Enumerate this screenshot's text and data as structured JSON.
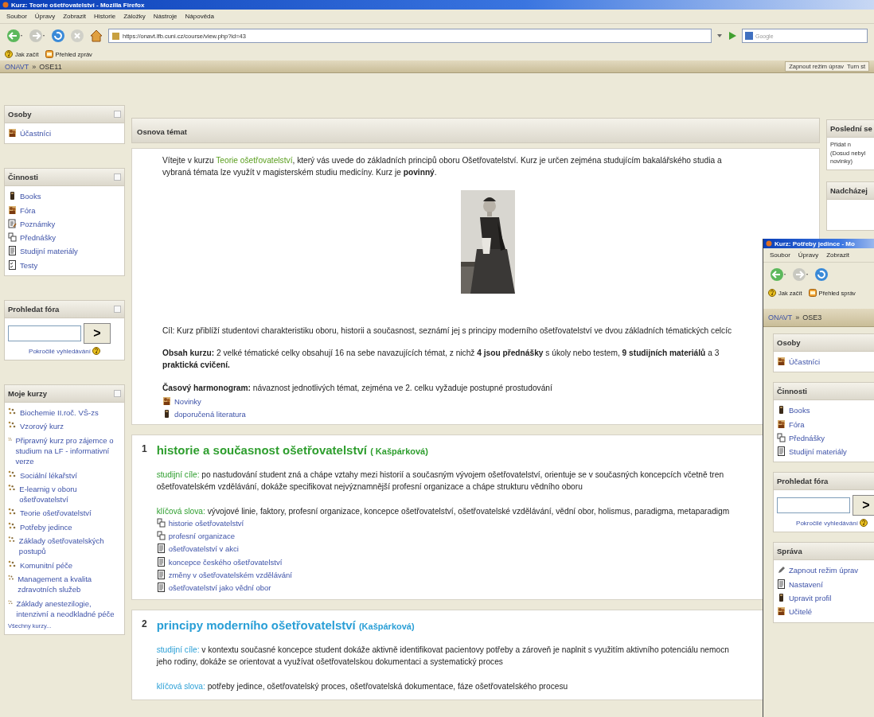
{
  "window": {
    "title": "Kurz: Teorie ošetřovatelství - Mozilla Firefox",
    "menu": [
      "Soubor",
      "Úpravy",
      "Zobrazit",
      "Historie",
      "Záložky",
      "Nástroje",
      "Nápověda"
    ],
    "address": "https://onavt.lfb.cuni.cz/course/view.php?id=43",
    "search_placeholder": "Google",
    "bookmarks": [
      {
        "label": "Jak začít",
        "kind": "help"
      },
      {
        "label": "Přehled zpráv",
        "kind": "feed"
      }
    ],
    "breadcrumb": {
      "home": "ONAVT",
      "separator": "»",
      "current": "OSE11"
    },
    "header_links": [
      "Zapnout režim úprav",
      "Turn st"
    ]
  },
  "left_blocks": [
    {
      "title": "Osoby",
      "kind": "list",
      "items": [
        {
          "label": "Účastníci",
          "kind": "people"
        }
      ]
    },
    {
      "title": "Činnosti",
      "kind": "list",
      "items": [
        {
          "label": "Books",
          "kind": "book"
        },
        {
          "label": "Fóra",
          "kind": "people"
        },
        {
          "label": "Poznámky",
          "kind": "notes"
        },
        {
          "label": "Přednášky",
          "kind": "lesson"
        },
        {
          "label": "Studijní materiály",
          "kind": "resource"
        },
        {
          "label": "Testy",
          "kind": "quiz"
        }
      ]
    },
    {
      "title": "Prohledat fóra",
      "kind": "search",
      "button": ">",
      "link": "Pokročilé vyhledávání"
    },
    {
      "title": "Moje kurzy",
      "kind": "list",
      "items": [
        {
          "label": "Biochemie II.roč. VŠ-zs",
          "kind": "course"
        },
        {
          "label": "Vzorový kurz",
          "kind": "course"
        },
        {
          "label": "Připravný kurz pro zájemce o studium na LF - informativní verze",
          "kind": "course"
        },
        {
          "label": "Sociální lékařství",
          "kind": "course"
        },
        {
          "label": "E-learnig v oboru ošetřovatelství",
          "kind": "course"
        },
        {
          "label": "Teorie ošetřovatelství",
          "kind": "course"
        },
        {
          "label": "Potřeby jedince",
          "kind": "course"
        },
        {
          "label": "Základy ošetřovatelských postupů",
          "kind": "course"
        },
        {
          "label": "Komunitní péče",
          "kind": "course"
        },
        {
          "label": "Management a kvalita zdravotních služeb",
          "kind": "course"
        },
        {
          "label": "Základy anestezilogie, intenzivní a neodkladné péče",
          "kind": "course"
        }
      ],
      "footer": "Všechny kurzy..."
    }
  ],
  "center": {
    "title": "Osnova témat",
    "intro": {
      "before": "Vítejte v kurzu ",
      "link": "Teorie ošetřovatelství",
      "after": ", který vás uvede do základních principů oboru Ošetřovatelství. Kurz je určen zejména studujícím bakalářského studia a vybraná témata lze využít v magisterském studiu medicíny. Kurz je **povinný**."
    },
    "paragraphs": [
      {
        "lines": [
          "Cíl: Kurz přiblíží studentovi charakteristiku oboru, historii a současnost, seznámí jej s principy moderního ošetřovatelství ve dvou základních tématických celcíc"
        ]
      },
      {
        "lines": [
          "**Obsah kurzu:** 2 velké tématické celky obsahují 16 na sebe navazujících témat, z nichž **4 jsou přednášky** s úkoly nebo testem, **9 studijních materiálů** a 3",
          "**praktická cvičení.**"
        ]
      },
      {
        "lines": [
          "**Časový harmonogram:** návaznost jednotlivých témat, zejména ve 2. celku vyžaduje postupné prostudování"
        ]
      }
    ],
    "links": [
      {
        "label": "Novinky",
        "kind": "people"
      },
      {
        "label": "doporučená literatura",
        "kind": "book"
      }
    ],
    "sections": [
      {
        "number": "1",
        "title": "historie a současnost ošetřovatelství",
        "author": "( Kašpárková)",
        "color": "#2e9e2e",
        "blocks": [
          {
            "label": "studijní cíle:",
            "lines": [
              "po nastudování student zná a chápe vztahy mezi historií a současným vývojem ošetřovatelství, orientuje se v současných koncepcích včetně tren",
              "ošetřovatelském vzdělávání, dokáže specifikovat nejvýznamnější profesní organizace a chápe strukturu vědního oboru"
            ]
          },
          {
            "label": "klíčová slova:",
            "lines": [
              "vývojové linie, faktory, profesní organizace, koncepce ošetřovatelství, ošetřovatelské vzdělávání, vědní obor, holismus, paradigma, metaparadigm"
            ]
          }
        ],
        "links": [
          {
            "label": "historie ošetřovatelství",
            "kind": "lesson"
          },
          {
            "label": "profesní organizace",
            "kind": "lesson"
          },
          {
            "label": "ošetřovatelství v akci",
            "kind": "resource"
          },
          {
            "label": "koncepce českého ošetřovatelství",
            "kind": "resource"
          },
          {
            "label": "změny v ošetřovatelském vzdělávání",
            "kind": "resource"
          },
          {
            "label": "ošetřovatelství jako vědní obor",
            "kind": "resource"
          }
        ]
      },
      {
        "number": "2",
        "title": "principy moderního ošetřovatelství",
        "author": "(Kašpárková)",
        "color": "#2a9fd6",
        "blocks": [
          {
            "label": "studijní cíle:",
            "lines": [
              "v kontextu současné koncepce student dokáže aktivně identifikovat pacientovy potřeby a zároveň je naplnit s využitím aktivního potenciálu nemocn",
              "jeho rodiny, dokáže se orientovat a využívat ošetřovatelskou dokumentaci a systematický proces"
            ]
          },
          {
            "label": "klíčová slova:",
            "lines": [
              "potřeby jedince, ošetřovatelský proces, ošetřovatelská dokumentace, fáze ošetřovatelského procesu"
            ]
          }
        ]
      }
    ]
  },
  "right_blocks": [
    {
      "title": "Poslední se",
      "lines": [
        "Přidat n",
        "(Dosud nebyl",
        "novinky)"
      ]
    },
    {
      "title": "Nadcházej"
    }
  ],
  "second_window": {
    "title": "Kurz: Potřeby jedince - Mo",
    "menu": [
      "Soubor",
      "Úpravy",
      "Zobrazit"
    ],
    "bookmarks": [
      {
        "label": "Jak začít",
        "kind": "help"
      },
      {
        "label": "Přehled správ",
        "kind": "feed"
      }
    ],
    "breadcrumb": {
      "home": "ONAVT",
      "separator": "»",
      "current": "OSE3"
    },
    "blocks": [
      {
        "title": "Osoby",
        "kind": "list",
        "items": [
          {
            "label": "Účastníci",
            "kind": "people"
          }
        ]
      },
      {
        "title": "Činnosti",
        "kind": "list",
        "items": [
          {
            "label": "Books",
            "kind": "book"
          },
          {
            "label": "Fóra",
            "kind": "people"
          },
          {
            "label": "Přednášky",
            "kind": "lesson"
          },
          {
            "label": "Studijní materiály",
            "kind": "resource"
          }
        ]
      },
      {
        "title": "Prohledat fóra",
        "kind": "search",
        "button": ">",
        "link": "Pokročilé vyhledávání"
      },
      {
        "title": "Správa",
        "kind": "list",
        "items": [
          {
            "label": "Zapnout režim úprav",
            "kind": "edit"
          },
          {
            "label": "Nastavení",
            "kind": "resource"
          },
          {
            "label": "Upravit profil",
            "kind": "book"
          },
          {
            "label": "Učitelé",
            "kind": "people"
          }
        ]
      }
    ]
  }
}
